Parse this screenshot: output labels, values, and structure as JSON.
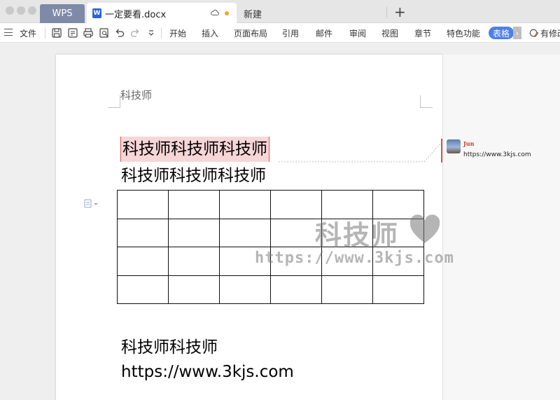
{
  "tabs": {
    "wps": "WPS",
    "document": "一定要看.docx",
    "new": "新建"
  },
  "toolbar": {
    "file": "文件",
    "menus": [
      "开始",
      "插入",
      "页面布局",
      "引用",
      "邮件",
      "审阅",
      "视图",
      "章节",
      "特色功能"
    ],
    "table_tab": "表格",
    "edit_status": "有修改"
  },
  "document": {
    "header": "科技师",
    "line1": "科技师科技师科技师",
    "line2": "科技师科技师科技师",
    "table": {
      "rows": 4,
      "cols": 6
    },
    "line3": "科技师科技师",
    "line4": "https://www.3kjs.com"
  },
  "comment": {
    "author": "Jun",
    "text": "https://www.3kjs.com"
  },
  "watermark": {
    "title": "科技师",
    "url": "https://www.3kjs.com"
  },
  "colors": {
    "accent": "#4f7fe8",
    "highlight": "#f7d6d8",
    "comment_author": "#c0392b",
    "modified_dot": "#f5a623"
  }
}
